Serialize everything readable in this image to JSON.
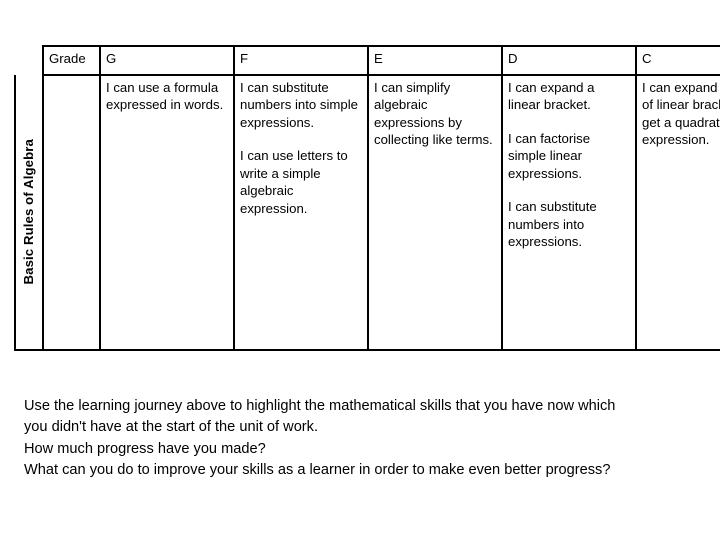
{
  "table": {
    "row_label": "Basic Rules of Algebra",
    "headers": {
      "grade": "Grade",
      "columns": [
        "G",
        "F",
        "E",
        "D",
        "C"
      ]
    },
    "cells": {
      "G": [
        "I can use a formula expressed in words."
      ],
      "F": [
        "I can substitute numbers into simple expressions.",
        "I can use letters to write a simple algebraic expression."
      ],
      "E": [
        "I can simplify algebraic expressions by collecting like terms."
      ],
      "D": [
        "I can expand a linear bracket.",
        "I can factorise simple linear expressions.",
        "I can substitute numbers into expressions."
      ],
      "C": [
        "I can expand a pair of linear brackets to get a quadratic expression."
      ]
    }
  },
  "footer": {
    "lines": [
      "Use the learning journey above to highlight the mathematical skills that you have now which",
      "you didn't have at the start of the unit of work.",
      "How much progress have you made?",
      "What can you do to improve your skills as a learner in order to make even better progress?"
    ]
  }
}
